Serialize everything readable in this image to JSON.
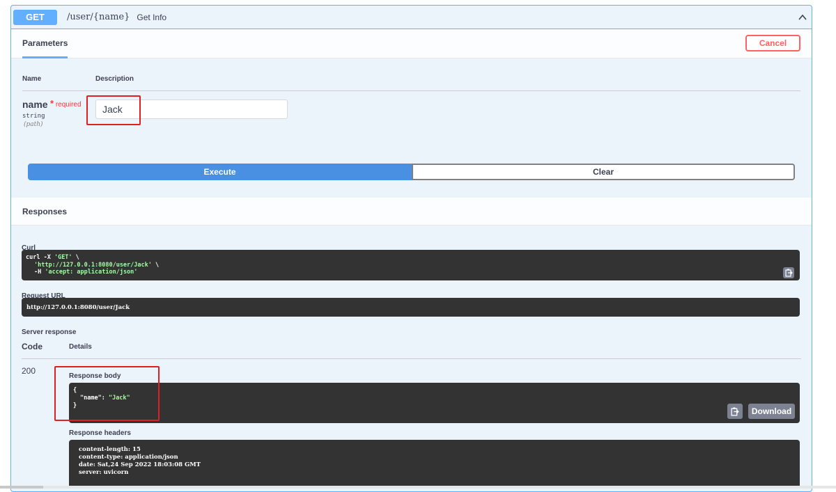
{
  "operation": {
    "method": "GET",
    "path": "/user/{name}",
    "summary": "Get Info",
    "method_color": "#61affe"
  },
  "parameters_section": {
    "tab_label": "Parameters",
    "cancel_label": "Cancel",
    "col_name": "Name",
    "col_description": "Description",
    "param": {
      "name": "name",
      "required_star": "*",
      "required_label": "required",
      "type": "string",
      "location": "(path)",
      "value": "Jack"
    },
    "execute_label": "Execute",
    "clear_label": "Clear"
  },
  "responses_section": {
    "title": "Responses",
    "curl_label": "Curl",
    "curl_line1_cmd": "curl -X ",
    "curl_line1_method": "'GET'",
    "curl_line1_end": " \\",
    "curl_line2": "'http://127.0.0.1:8080/user/Jack'",
    "curl_line2_end": " \\",
    "curl_line3_flag": "-H ",
    "curl_line3_val": "'accept: application/json'",
    "request_url_label": "Request URL",
    "request_url": "http://127.0.0.1:8080/user/Jack",
    "server_response_label": "Server response",
    "code_header": "Code",
    "details_header": "Details",
    "status_code": "200",
    "response_body_label": "Response body",
    "body_open": "{",
    "body_key": "\"name\": ",
    "body_value": "\"Jack\"",
    "body_close": "}",
    "download_label": "Download",
    "response_headers_label": "Response headers",
    "headers": [
      " content-length: 15 ",
      " content-type: application/json ",
      " date: Sat,24 Sep 2022 18:03:08 GMT ",
      " server: uvicorn "
    ]
  },
  "icons": {
    "collapse": "chevron-up-icon",
    "copy": "copy-icon"
  },
  "colors": {
    "accent": "#61affe",
    "execute": "#4990e2",
    "cancel": "#ff6060",
    "highlight": "#e02020",
    "code_bg": "#333333"
  }
}
